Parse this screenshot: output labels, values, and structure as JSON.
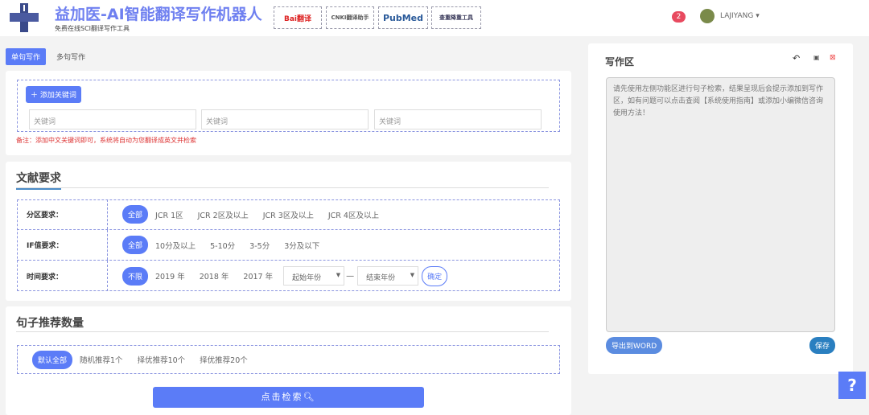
{
  "header": {
    "title": "益加医-AI智能翻译写作机器人",
    "subtitle": "免费在线SCI翻译写作工具",
    "links": [
      {
        "label": "Bai翻译",
        "name": "baidu"
      },
      {
        "label": "CNKI翻译助手",
        "name": "cnki"
      },
      {
        "label": "PubMed",
        "name": "pubmed"
      },
      {
        "label": "查重降重工具",
        "name": "plagiarism"
      }
    ],
    "notifications": "2",
    "username": "LAJIYANG"
  },
  "tabs": [
    "单句写作",
    "多句写作"
  ],
  "keywords": {
    "add_label": "添加关键词",
    "placeholder": "关键词",
    "note": "备注：添加中文关键词即可，系统将自动为您翻译成英文并检索"
  },
  "literature": {
    "title": "文献要求",
    "zone": {
      "label": "分区要求：",
      "options": [
        "全部",
        "JCR 1区",
        "JCR 2区及以上",
        "JCR 3区及以上",
        "JCR 4区及以上"
      ]
    },
    "if": {
      "label": "IF值要求：",
      "options": [
        "全部",
        "10分及以上",
        "5-10分",
        "3-5分",
        "3分及以下"
      ]
    },
    "time": {
      "label": "时间要求：",
      "options": [
        "不限",
        "2019 年",
        "2018 年",
        "2017 年"
      ],
      "start": "起始年份",
      "end": "结束年份",
      "confirm": "确定"
    }
  },
  "count": {
    "title": "句子推荐数量",
    "options": [
      "默认全部",
      "随机推荐1个",
      "择优推荐10个",
      "择优推荐20个"
    ]
  },
  "search_label": "点击检索",
  "writing": {
    "title": "写作区",
    "text": "请先使用左侧功能区进行句子检索，结果呈现后会提示添加到写作区，如有问题可以点击查阅【系统使用指南】或添加小编微信咨询使用方法！",
    "export": "导出到WORD",
    "save": "保存"
  },
  "help": "?"
}
